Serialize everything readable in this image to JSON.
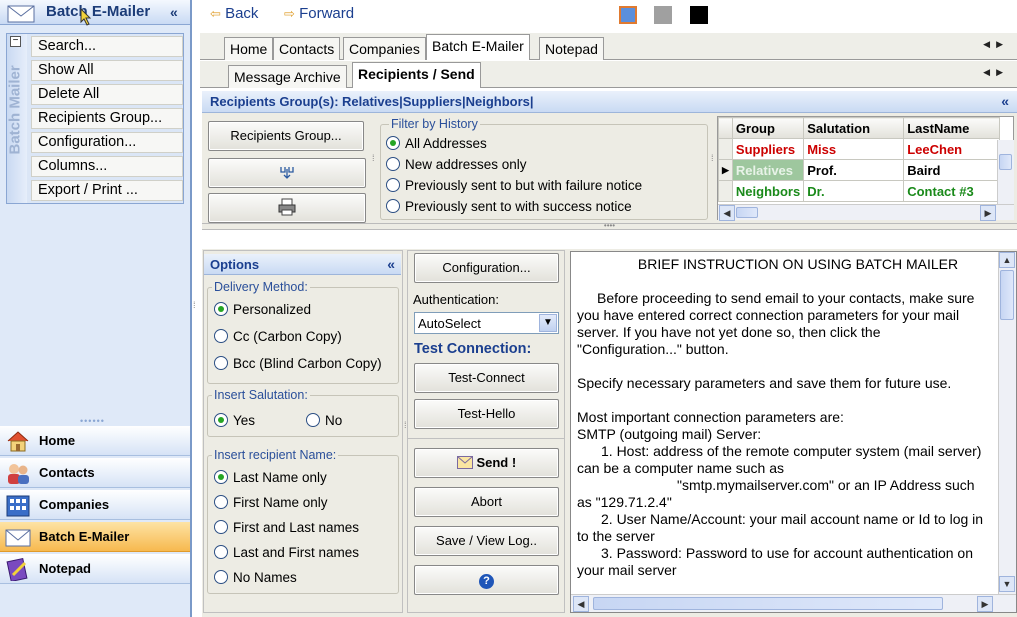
{
  "left": {
    "title": "Batch E-Mailer",
    "collapse": "«",
    "strip_label": "Batch Mailer",
    "tasks": [
      "Search...",
      "Show All",
      "Delete All",
      "Recipients Group...",
      "Configuration...",
      "Columns...",
      "Export / Print ..."
    ],
    "nav": [
      {
        "label": "Home",
        "icon": "home-icon"
      },
      {
        "label": "Contacts",
        "icon": "contacts-icon"
      },
      {
        "label": "Companies",
        "icon": "companies-icon"
      },
      {
        "label": "Batch E-Mailer",
        "icon": "envelope-icon",
        "selected": true
      },
      {
        "label": "Notepad",
        "icon": "notepad-icon"
      }
    ]
  },
  "toolbar": {
    "back": "Back",
    "forward": "Forward",
    "colors": [
      "#5b8fdc",
      "#a0a0a0",
      "#000000"
    ]
  },
  "tabs": [
    "Home",
    "Contacts",
    "Companies",
    "Batch E-Mailer",
    "Notepad"
  ],
  "subtabs": [
    "Message Archive",
    "Recipients / Send"
  ],
  "recipients": {
    "label": "Recipients Group(s):",
    "value": "Relatives|Suppliers|Neighbors|",
    "collapse": "«"
  },
  "top_buttons": {
    "recipients_group": "Recipients Group..."
  },
  "filter": {
    "title": "Filter by History",
    "options": [
      "All Addresses",
      "New addresses only",
      "Previously sent to but with failure notice",
      "Previously sent to with success notice"
    ],
    "selected": 0
  },
  "grid": {
    "columns": [
      "Group",
      "Salutation",
      "LastName"
    ],
    "rows": [
      {
        "group": "Suppliers",
        "salutation": "Miss",
        "lastname": "LeeChen",
        "color": "#cc0000"
      },
      {
        "group": "Relatives",
        "salutation": "Prof.",
        "lastname": "Baird",
        "color": "#000000"
      },
      {
        "group": "Neighbors",
        "salutation": "Dr.",
        "lastname": "Contact #3",
        "color": "#1a8a1a"
      }
    ]
  },
  "options": {
    "title": "Options",
    "collapse": "«",
    "delivery": {
      "title": "Delivery Method:",
      "options": [
        "Personalized",
        "Cc (Carbon Copy)",
        "Bcc (Blind Carbon Copy)"
      ],
      "selected": 0
    },
    "salutation": {
      "title": "Insert Salutation:",
      "options": [
        "Yes",
        "No"
      ],
      "selected": 0
    },
    "name": {
      "title": "Insert recipient Name:",
      "options": [
        "Last Name only",
        "First Name only",
        "First and Last names",
        "Last and First names",
        "No Names"
      ],
      "selected": 0
    }
  },
  "actions": {
    "configuration": "Configuration...",
    "auth_label": "Authentication:",
    "auth_value": "AutoSelect",
    "test_label": "Test Connection:",
    "test_connect": "Test-Connect",
    "test_hello": "Test-Hello",
    "send": "Send !",
    "abort": "Abort",
    "savelog": "Save / View Log..",
    "help": "?"
  },
  "instructions": {
    "title": "BRIEF INSTRUCTION ON USING BATCH MAILER",
    "p1": "Before proceeding to send email to your contacts, make sure you have entered correct connection parameters for your mail server. If you have not yet done so, then click the \"Configuration...\" button.",
    "p2": "Specify necessary parameters and save them for future use.",
    "p3a": "Most important connection parameters are:",
    "p3b": "SMTP (outgoing mail) Server:",
    "p3c": "1. Host: address of the remote computer system (mail server) can be a computer name such as",
    "p3d": "\"smtp.mymailserver.com\" or an IP Address such as \"129.71.2.4\"",
    "p3e": "2. User Name/Account:  your mail account name or Id to log in to the server",
    "p3f": "3. Password: Password to use for account authentication on your mail server"
  }
}
